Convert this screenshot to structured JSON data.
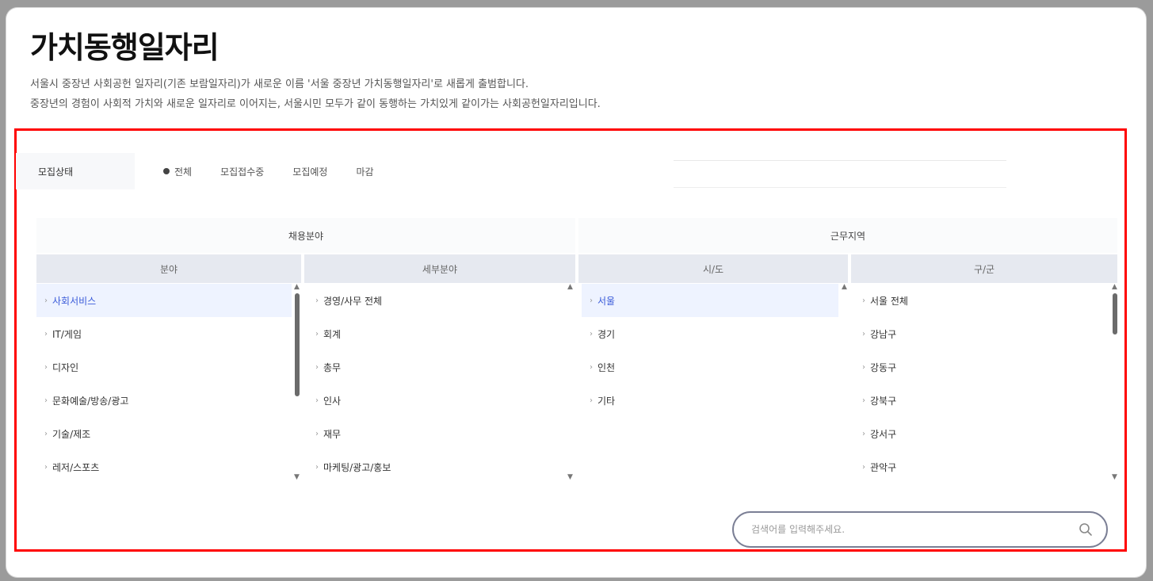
{
  "page": {
    "title": "가치동행일자리",
    "desc_line1": "서울시 중장년 사회공헌 일자리(기존 보람일자리)가 새로운 이름 '서울 중장년 가치동행일자리'로 새롭게 출범합니다.",
    "desc_line2": "중장년의 경험이 사회적 가치와 새로운 일자리로 이어지는, 서울시민 모두가 같이 동행하는 가치있게 같이가는 사회공헌일자리입니다."
  },
  "filter": {
    "label": "모집상태",
    "options": [
      "전체",
      "모집접수중",
      "모집예정",
      "마감"
    ],
    "selected": "전체"
  },
  "groups": {
    "job": "채용분야",
    "region": "근무지역"
  },
  "columns": {
    "c1": "분야",
    "c2": "세부분야",
    "c3": "시/도",
    "c4": "구/군"
  },
  "lists": {
    "c1": [
      "사회서비스",
      "IT/게임",
      "디자인",
      "문화예술/방송/광고",
      "기술/제조",
      "레저/스포츠"
    ],
    "c2": [
      "경영/사무 전체",
      "회계",
      "총무",
      "인사",
      "재무",
      "마케팅/광고/홍보"
    ],
    "c3": [
      "서울",
      "경기",
      "인천",
      "기타"
    ],
    "c4": [
      "서울 전체",
      "강남구",
      "강동구",
      "강북구",
      "강서구",
      "관악구"
    ]
  },
  "search": {
    "placeholder": "검색어를 입력해주세요."
  },
  "colors": {
    "accent": "#3a5bd9",
    "highlight": "#ff0000",
    "header_bg": "#e6e9f0"
  }
}
